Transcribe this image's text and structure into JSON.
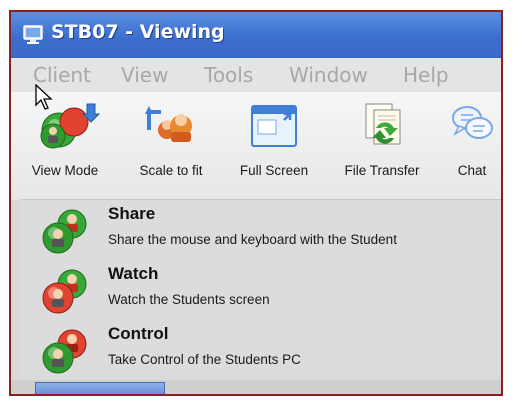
{
  "window": {
    "title": "STB07 - Viewing",
    "title_color": "#3d6fd0"
  },
  "menu": {
    "items": [
      {
        "label": "Client"
      },
      {
        "label": "View"
      },
      {
        "label": "Tools"
      },
      {
        "label": "Window"
      },
      {
        "label": "Help"
      }
    ]
  },
  "toolbar": {
    "buttons": [
      {
        "label": "View Mode",
        "icon": "view-mode-icon"
      },
      {
        "label": "Scale to fit",
        "icon": "scale-to-fit-icon"
      },
      {
        "label": "Full Screen",
        "icon": "full-screen-icon"
      },
      {
        "label": "File Transfer",
        "icon": "file-transfer-icon"
      },
      {
        "label": "Chat",
        "icon": "chat-icon"
      }
    ]
  },
  "view_mode_menu": {
    "options": [
      {
        "title": "Share",
        "description": "Share the mouse and keyboard with the Student",
        "icon": "share-icon"
      },
      {
        "title": "Watch",
        "description": "Watch the Students screen",
        "icon": "watch-icon"
      },
      {
        "title": "Control",
        "description": "Take Control of the Students PC",
        "icon": "control-icon"
      }
    ]
  }
}
